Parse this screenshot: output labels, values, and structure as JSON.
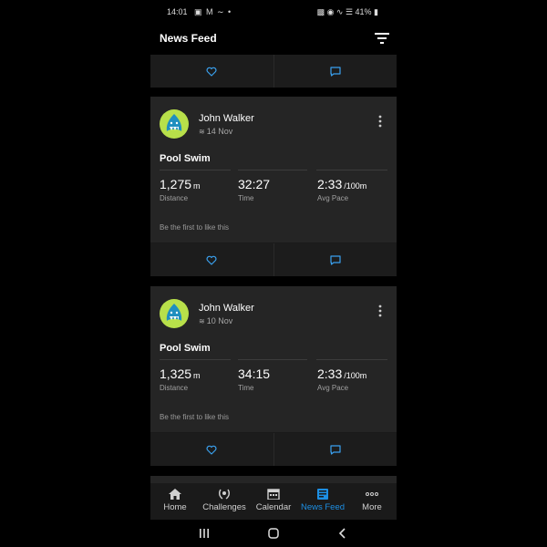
{
  "status_bar": {
    "time": "14:01",
    "battery": "41%"
  },
  "app_bar": {
    "title": "News Feed"
  },
  "activities": [
    {
      "user": "John Walker",
      "date": "14 Nov",
      "title": "Pool Swim",
      "distance": {
        "value": "1,275",
        "unit": "m",
        "label": "Distance"
      },
      "time": {
        "value": "32:27",
        "label": "Time"
      },
      "pace": {
        "value": "2:33",
        "unit": "/100m",
        "label": "Avg Pace"
      },
      "likes_text": "Be the first to like this"
    },
    {
      "user": "John Walker",
      "date": "10 Nov",
      "title": "Pool Swim",
      "distance": {
        "value": "1,325",
        "unit": "m",
        "label": "Distance"
      },
      "time": {
        "value": "34:15",
        "label": "Time"
      },
      "pace": {
        "value": "2:33",
        "unit": "/100m",
        "label": "Avg Pace"
      },
      "likes_text": "Be the first to like this"
    }
  ],
  "bottom_nav": {
    "items": [
      {
        "label": "Home",
        "icon": "home-icon"
      },
      {
        "label": "Challenges",
        "icon": "laurel-icon"
      },
      {
        "label": "Calendar",
        "icon": "calendar-icon"
      },
      {
        "label": "News Feed",
        "icon": "news-feed-icon",
        "active": true
      },
      {
        "label": "More",
        "icon": "more-dots-icon"
      }
    ]
  },
  "colors": {
    "accent": "#1d8fe3",
    "card": "#252525",
    "background": "#000000"
  }
}
